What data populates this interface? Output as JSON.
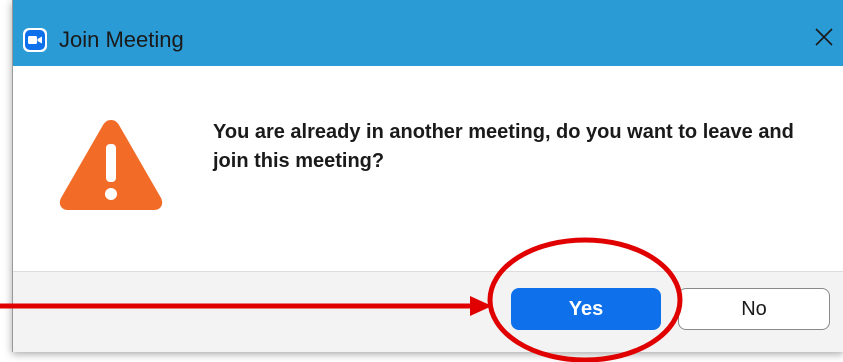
{
  "window": {
    "title": "Join Meeting",
    "app_icon": "zoom-camera-icon",
    "close_icon": "close-icon"
  },
  "dialog": {
    "icon": "warning-triangle-icon",
    "message": "You are already in another meeting, do you want to leave and join this meeting?"
  },
  "buttons": {
    "yes_label": "Yes",
    "no_label": "No"
  },
  "colors": {
    "titlebar": "#2b9bd5",
    "primary_button": "#0e71eb",
    "warning": "#f26c27",
    "annotation": "#e00000"
  }
}
